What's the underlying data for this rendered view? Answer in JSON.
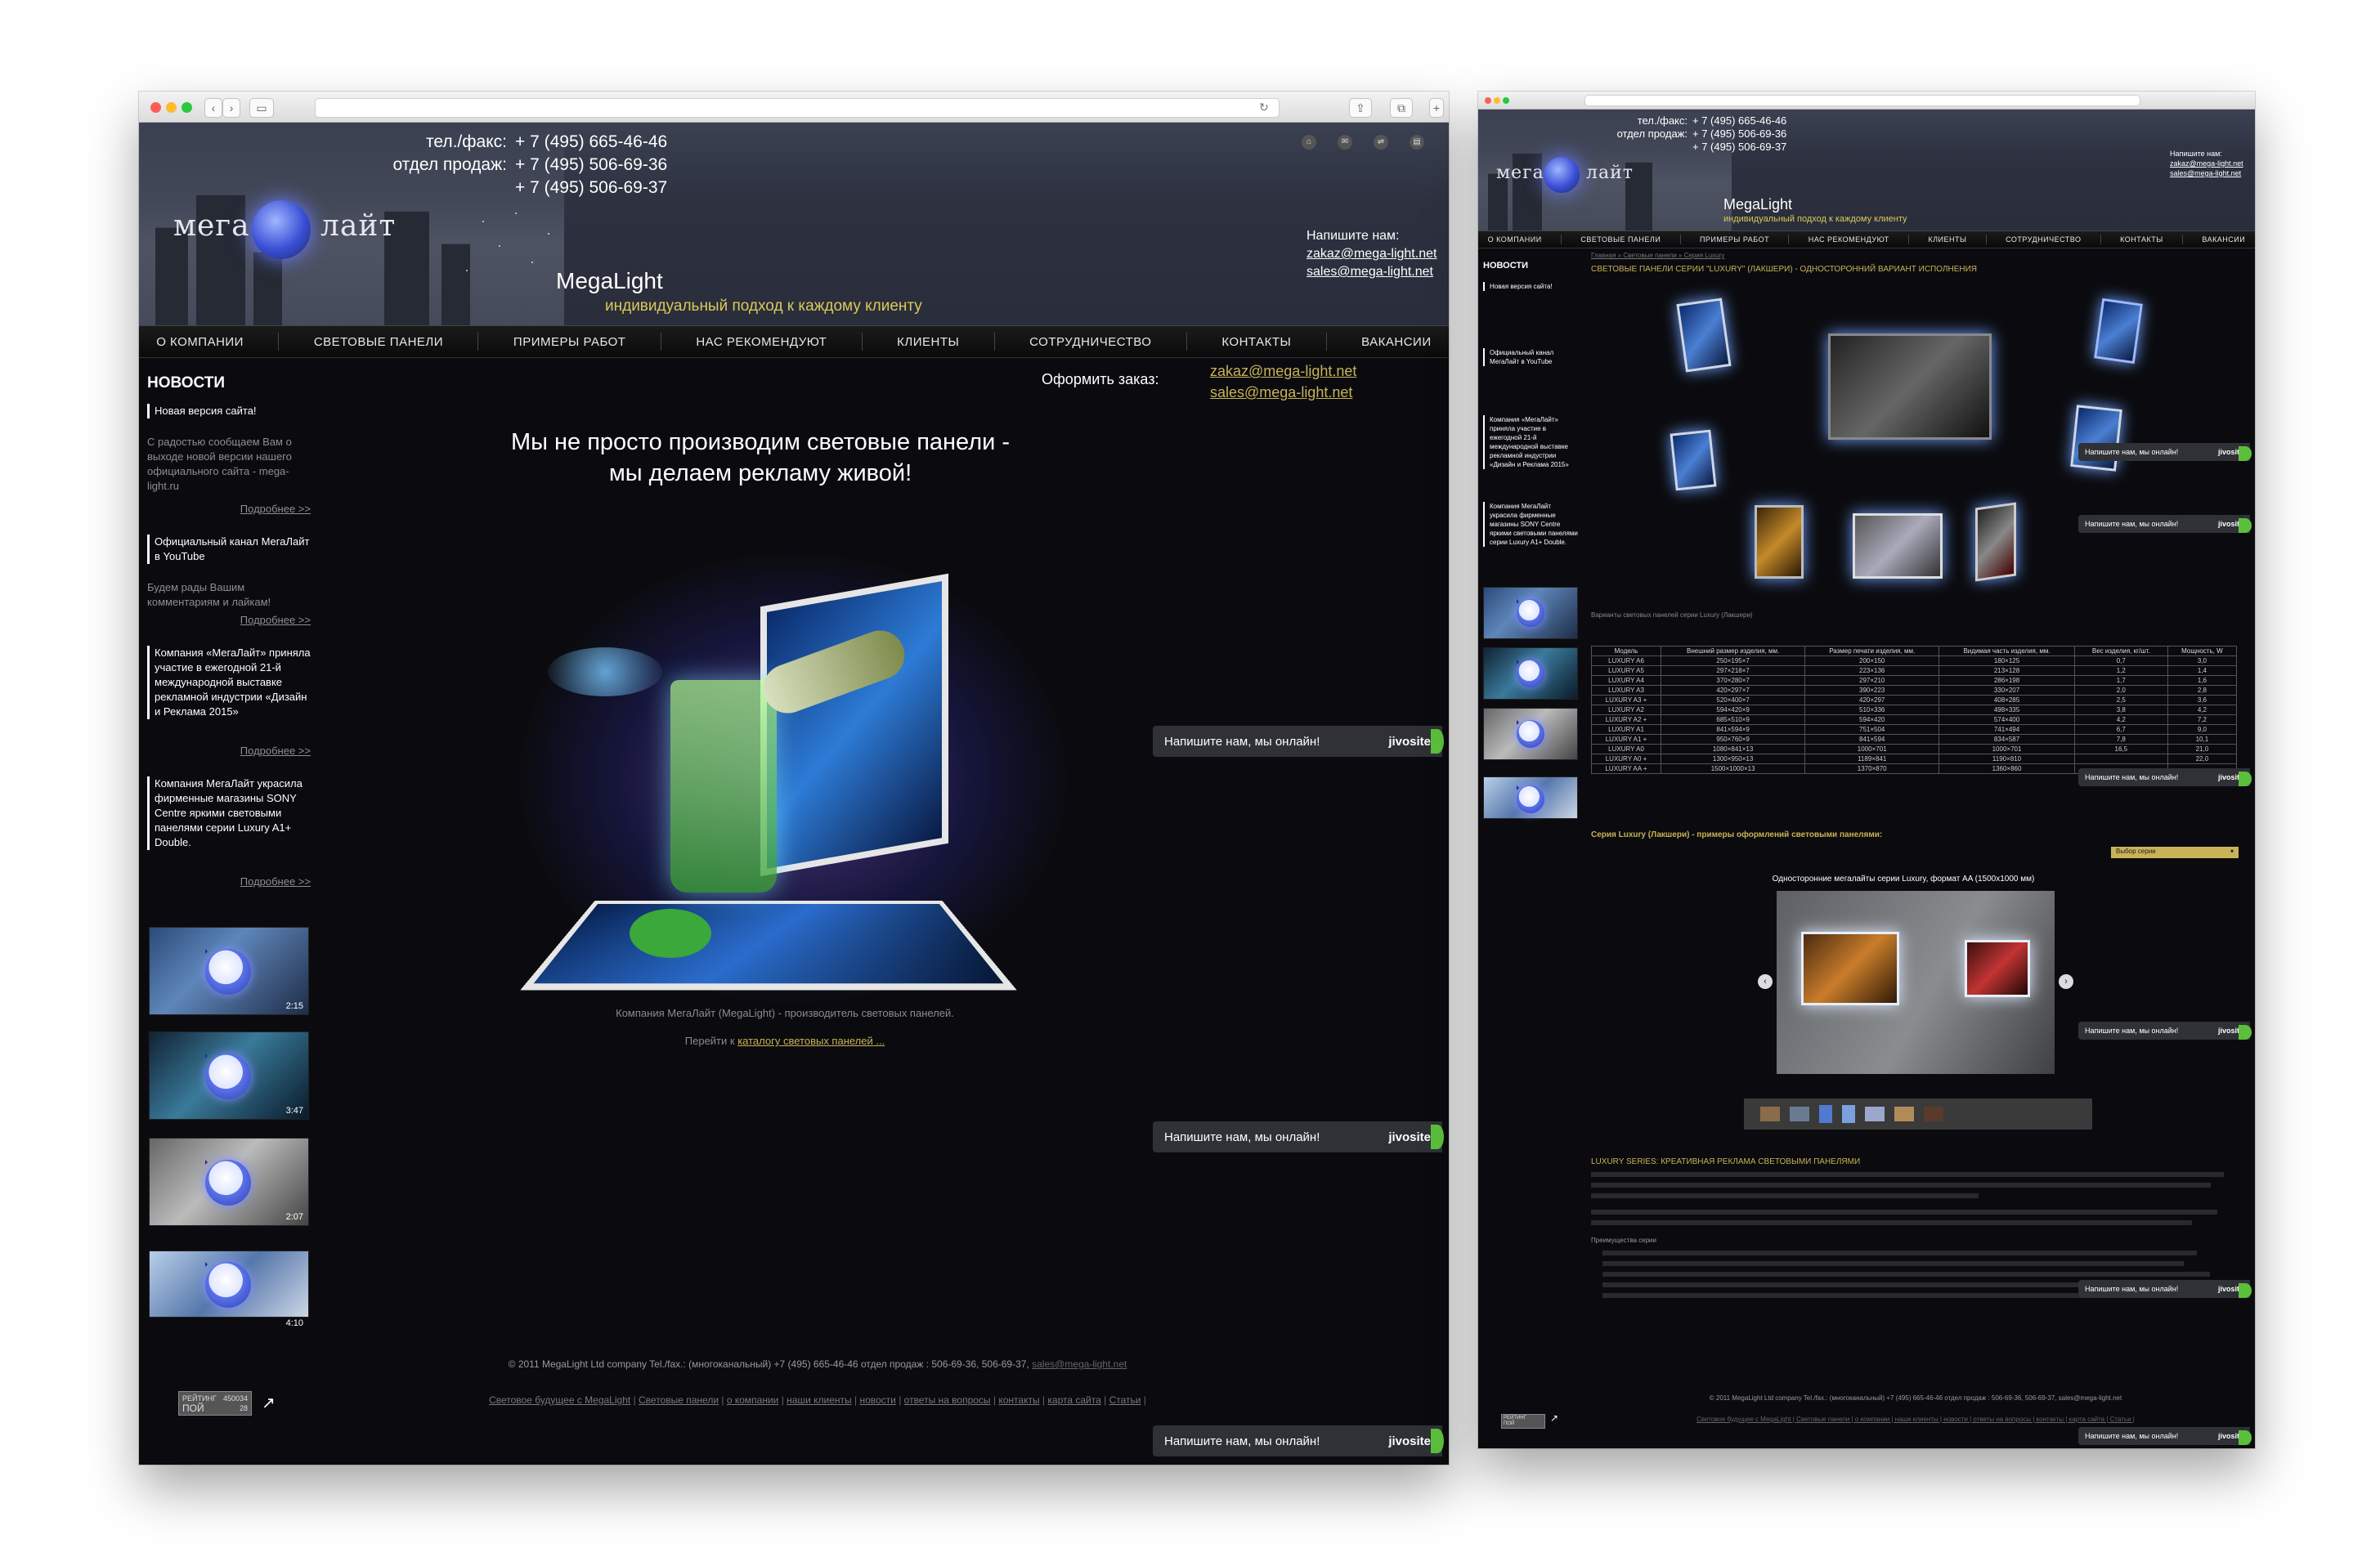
{
  "left": {
    "phone_label_1": "тел./факс:",
    "phone_1": "+ 7 (495) 665-46-46",
    "phone_label_2": "отдел продаж:",
    "phone_2": "+ 7 (495) 506-69-36",
    "phone_3": "+ 7 (495) 506-69-37",
    "write_us": "Напишите нам:",
    "email_1": "zakaz@mega-light.net",
    "email_2": "sales@mega-light.net",
    "logo_left": "мега",
    "logo_right": "лайт",
    "brand": "MegaLight",
    "slogan": "индивидуальный подход к каждому клиенту",
    "nav": [
      "О КОМПАНИИ",
      "СВЕТОВЫЕ ПАНЕЛИ",
      "ПРИМЕРЫ РАБОТ",
      "НАС РЕКОМЕНДУЮТ",
      "КЛИЕНТЫ",
      "СОТРУДНИЧЕСТВО",
      "КОНТАКТЫ",
      "ВАКАНСИИ"
    ],
    "news_title": "НОВОСТИ",
    "news": [
      {
        "title": "Новая версия сайта!",
        "body": "С радостью сообщаем Вам о выходе новой версии нашего официального сайта - mega-light.ru",
        "more": "Подробнее >>"
      },
      {
        "title": "Официальный канал МегаЛайт в YouTube",
        "body": "Будем рады Вашим комментариям и лайкам!",
        "more": "Подробнее >>"
      },
      {
        "title": "Компания «МегаЛайт» приняла участие в ежегодной 21-й международной выставке рекламной индустрии «Дизайн и Реклама 2015»",
        "body": "",
        "more": "Подробнее >>"
      },
      {
        "title": "Компания МегаЛайт украсила фирменные магазины SONY Centre яркими световыми панелями серии Luxury A1+ Double.",
        "body": "",
        "more": "Подробнее >>"
      }
    ],
    "videos": [
      "2:15",
      "3:47",
      "2:07",
      "4:10"
    ],
    "order_label": "Оформить заказ:",
    "hero_line_1": "Мы не просто производим световые панели -",
    "hero_line_2": "мы делаем рекламу живой!",
    "company_text": "Компания МегаЛайт (MegaLight) - производитель световых панелей.",
    "catalog_prefix": "Перейти к ",
    "catalog_link": "каталогу световых панелей ...",
    "copyright": "© 2011 MegaLight Ltd company Tel./fax.: (многоканальный) +7 (495) 665-46-46 отдел продаж : 506-69-36, 506-69-37, ",
    "copyright_email": "sales@mega-light.net",
    "footer_links": [
      "Световое будущее с MegaLight",
      "Световые панели",
      "о компании",
      "наши клиенты",
      "новости",
      "ответы на вопросы",
      "контакты",
      "карта сайта",
      "Статьи"
    ],
    "counter_line_1": "РЕЙТИНГ",
    "counter_line_2": "ПОЙ",
    "counter_num": "450034",
    "counter_sub": "28"
  },
  "jivosite": {
    "text": "Напишите нам, мы онлайн!",
    "brand": "jivosite"
  },
  "right": {
    "phone_label_1": "тел./факс:",
    "phone_1": "+ 7 (495) 665-46-46",
    "phone_label_2": "отдел продаж:",
    "phone_2": "+ 7 (495) 506-69-36",
    "phone_3": "+ 7 (495) 506-69-37",
    "write_us": "Напишите нам:",
    "email_1": "zakaz@mega-light.net",
    "email_2": "sales@mega-light.net",
    "brand": "MegaLight",
    "slogan": "индивидуальный подход к каждому клиенту",
    "nav": [
      "О КОМПАНИИ",
      "СВЕТОВЫЕ ПАНЕЛИ",
      "ПРИМЕРЫ РАБОТ",
      "НАС РЕКОМЕНДУЮТ",
      "КЛИЕНТЫ",
      "СОТРУДНИЧЕСТВО",
      "КОНТАКТЫ",
      "ВАКАНСИИ"
    ],
    "breadcrumb": "Главная » Световые панели » Серия Luxury",
    "page_title": "СВЕТОВЫЕ ПАНЕЛИ СЕРИИ \"LUXURY\" (ЛАКШЕРИ) - ОДНОСТОРОННИЙ ВАРИАНТ ИСПОЛНЕНИЯ",
    "variants_caption": "Варианты световых панелей серии Luxury (Лакшери)",
    "news_title": "НОВОСТИ",
    "news": [
      "Новая версия сайта!",
      "Официальный канал МегаЛайт в YouTube",
      "Компания «МегаЛайт» приняла участие в ежегодной 21-й международной выставке рекламной индустрии «Дизайн и Реклама 2015»",
      "Компания МегаЛайт украсила фирменные магазины SONY Centre яркими световыми панелями серии Luxury A1+ Double."
    ],
    "table_head": [
      "Модель",
      "Внешний размер изделия, мм.",
      "Размер печати изделия, мм.",
      "Видимая часть изделия, мм.",
      "Вес изделия, кг/шт.",
      "Мощность, W"
    ],
    "table_rows": [
      [
        "LUXURY A6",
        "250×195×7",
        "200×150",
        "180×125",
        "0,7",
        "3,0"
      ],
      [
        "LUXURY A5",
        "297×218×7",
        "223×136",
        "213×128",
        "1,2",
        "1,4"
      ],
      [
        "LUXURY A4",
        "370×280×7",
        "297×210",
        "286×198",
        "1,7",
        "1,6"
      ],
      [
        "LUXURY A3",
        "420×297×7",
        "390×223",
        "330×207",
        "2,0",
        "2,8"
      ],
      [
        "LUXURY A3 +",
        "520×400×7",
        "420×297",
        "408×285",
        "2,5",
        "3,6"
      ],
      [
        "LUXURY A2",
        "594×420×9",
        "510×336",
        "498×335",
        "3,8",
        "4,2"
      ],
      [
        "LUXURY A2 +",
        "685×510×9",
        "594×420",
        "574×400",
        "4,2",
        "7,2"
      ],
      [
        "LUXURY A1",
        "841×594×9",
        "751×504",
        "741×494",
        "6,7",
        "9,0"
      ],
      [
        "LUXURY A1 +",
        "950×760×9",
        "841×594",
        "834×587",
        "7,8",
        "10,1"
      ],
      [
        "LUXURY A0",
        "1080×841×13",
        "1000×701",
        "1000×701",
        "16,5",
        "21,0"
      ],
      [
        "LUXURY A0 +",
        "1300×950×13",
        "1189×841",
        "1190×810",
        "",
        "22,0"
      ],
      [
        "LUXURY AA +",
        "1500×1000×13",
        "1370×870",
        "1360×860",
        "",
        ""
      ]
    ],
    "series_heading": "Серия Luxury (Лакшери) - примеры оформлений световыми панелями:",
    "select_label": "Выбор серии",
    "slider_caption": "Односторонние мегалайты серии Luxury, формат AA (1500x1000 мм)",
    "section_title": "LUXURY SERIES: КРЕАТИВНАЯ РЕКЛАМА СВЕТОВЫМИ ПАНЕЛЯМИ",
    "advantages_title": "Преимущества серии",
    "copyright": "© 2011 MegaLight Ltd company Tel./fax.: (многоканальный) +7 (495) 665-46-46 отдел продаж : 506-69-36, 506-69-37, sales@mega-light.net",
    "footer_links": "Световое будущее с MegaLight | Световые панели | о компании | наши клиенты | новости | ответы на вопросы | контакты | карта сайта | Статьи |",
    "counter_line_1": "РЕЙТИНГ",
    "counter_line_2": "ПОЙ"
  }
}
